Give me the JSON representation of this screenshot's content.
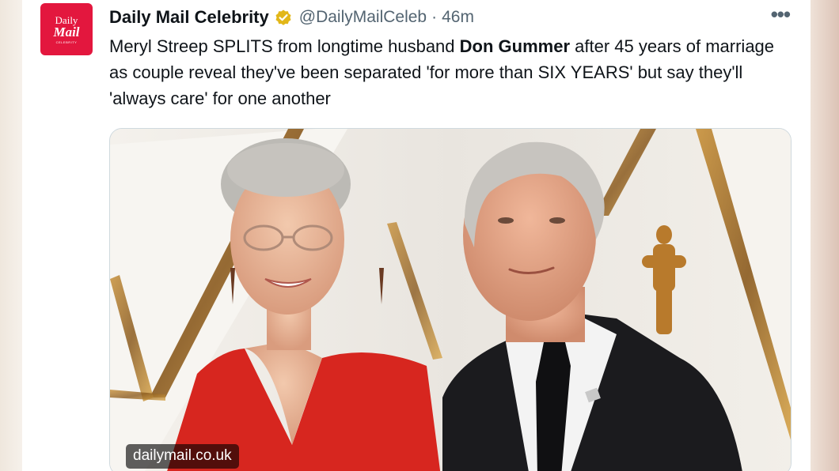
{
  "tweet": {
    "avatar": {
      "line1": "Daily",
      "line2": "Mail",
      "line3": "CELEBRITY"
    },
    "author_name": "Daily Mail Celebrity",
    "verified_icon": "verified-badge-icon",
    "handle": "@DailyMailCeleb",
    "separator": "·",
    "timestamp": "46m",
    "more_label": "•••",
    "text_before_bold": "Meryl Streep SPLITS from longtime husband ",
    "text_bold": "Don Gummer",
    "text_after_bold": " after 45 years of marriage as couple reveal they've been separated 'for more than SIX YEARS' but say they'll 'always care' for one another",
    "media": {
      "source_label": "dailymail.co.uk"
    }
  },
  "colors": {
    "brand_red": "#e3173e",
    "verified_gold": "#e2b719",
    "text_primary": "#0f1419",
    "text_secondary": "#536471"
  }
}
